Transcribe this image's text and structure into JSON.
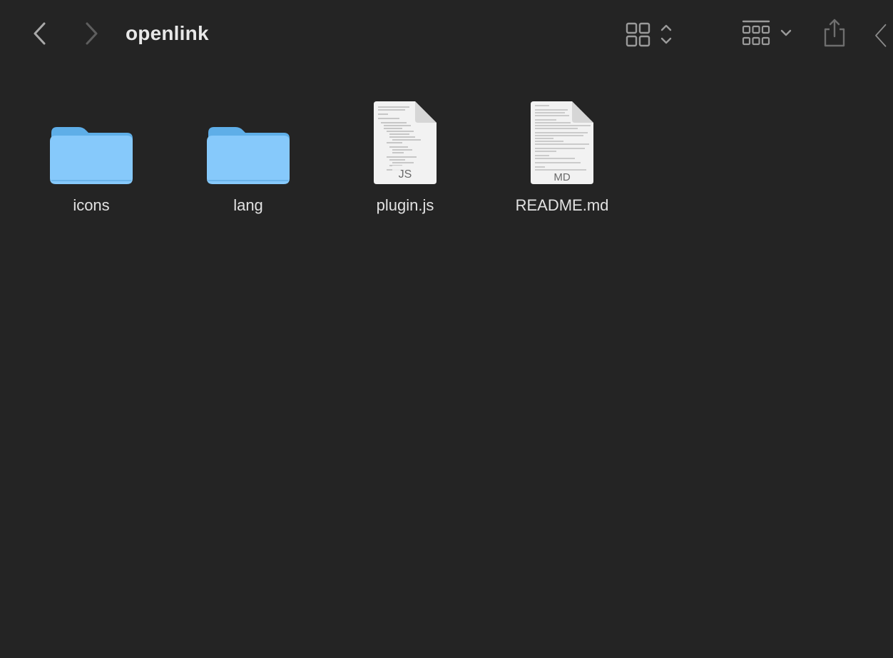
{
  "window": {
    "title": "openlink"
  },
  "toolbar": {
    "back_icon": "chevron-left-icon",
    "forward_icon": "chevron-right-icon",
    "view_icon": "grid-view-icon",
    "group_icon": "group-by-icon",
    "share_icon": "share-icon",
    "more_icon": "chevron-left-icon"
  },
  "items": [
    {
      "name": "icons",
      "kind": "folder",
      "icon": "folder-icon"
    },
    {
      "name": "lang",
      "kind": "folder",
      "icon": "folder-icon"
    },
    {
      "name": "plugin.js",
      "kind": "document",
      "icon": "document-icon",
      "ext": "JS"
    },
    {
      "name": "README.md",
      "kind": "document",
      "icon": "document-icon",
      "ext": "MD"
    }
  ],
  "colors": {
    "background": "#242424",
    "folder_top": "#6cbcf5",
    "folder_front": "#86c9fb",
    "toolbar_icon": "#9a9a9a",
    "toolbar_icon_dim": "#5e5e5e"
  }
}
